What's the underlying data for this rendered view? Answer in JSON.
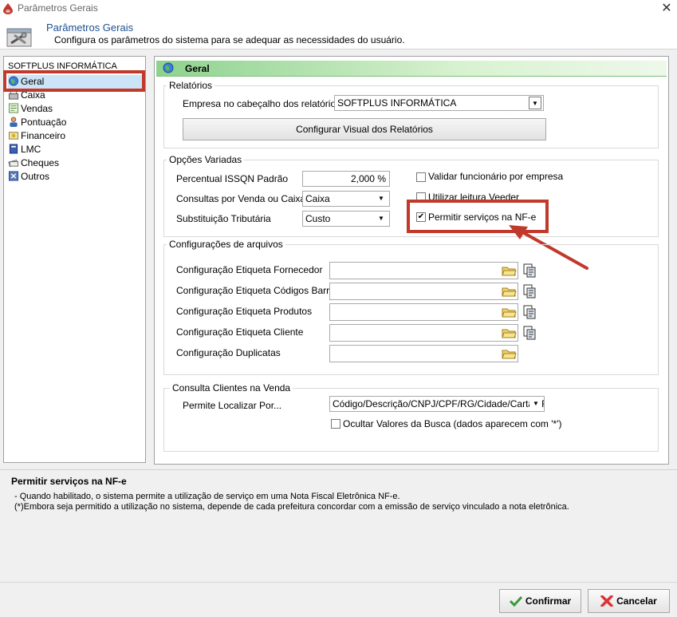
{
  "window": {
    "title": "Parâmetros Gerais"
  },
  "header": {
    "title": "Parâmetros Gerais",
    "description": "Configura os parâmetros do sistema para se adequar as necessidades do usuário."
  },
  "tree": {
    "root": "SOFTPLUS INFORMÁTICA",
    "items": [
      {
        "label": "Geral",
        "icon": "globe-icon",
        "selected": true
      },
      {
        "label": "Caixa",
        "icon": "cash-register-icon"
      },
      {
        "label": "Vendas",
        "icon": "sales-icon"
      },
      {
        "label": "Pontuação",
        "icon": "person-icon"
      },
      {
        "label": "Financeiro",
        "icon": "finance-icon"
      },
      {
        "label": "LMC",
        "icon": "book-icon"
      },
      {
        "label": "Cheques",
        "icon": "checks-icon"
      },
      {
        "label": "Outros",
        "icon": "others-icon"
      }
    ]
  },
  "section": {
    "title": "Geral"
  },
  "relatorios": {
    "title": "Relatórios",
    "empresa_label": "Empresa no cabeçalho dos relatórios",
    "empresa_value": "SOFTPLUS INFORMÁTICA",
    "configurar_button": "Configurar Visual dos Relatórios"
  },
  "opcoes": {
    "title": "Opções Variadas",
    "issqn_label": "Percentual ISSQN Padrão",
    "issqn_value": "2,000 %",
    "consultas_label": "Consultas por Venda ou Caixa",
    "consultas_value": "Caixa",
    "substituicao_label": "Substituição Tributária",
    "substituicao_value": "Custo",
    "chk_validar": {
      "label": "Validar funcionário por empresa",
      "checked": false
    },
    "chk_veeder": {
      "label": "Utilizar leitura Veeder",
      "checked": false
    },
    "chk_nfe": {
      "label": "Permitir serviços na NF-e",
      "checked": true
    }
  },
  "arquivos": {
    "title": "Configurações de arquivos",
    "rows": [
      {
        "label": "Configuração Etiqueta Fornecedor",
        "value": "",
        "copy": true
      },
      {
        "label": "Configuração Etiqueta Códigos Barras",
        "value": "",
        "copy": true
      },
      {
        "label": "Configuração Etiqueta Produtos",
        "value": "",
        "copy": true
      },
      {
        "label": "Configuração Etiqueta Cliente",
        "value": "",
        "copy": true
      },
      {
        "label": "Configuração Duplicatas",
        "value": "",
        "copy": false
      }
    ]
  },
  "clientes": {
    "title": "Consulta Clientes na Venda",
    "localizar_label": "Permite Localizar Por...",
    "localizar_value": "Código/Descrição/CNPJ/CPF/RG/Cidade/Cartão Fide",
    "chk_ocultar": {
      "label": "Ocultar Valores da Busca (dados aparecem com '*')",
      "checked": false
    }
  },
  "help": {
    "title": "Permitir serviços na NF-e",
    "line1": "- Quando habilitado, o sistema permite a utilização de serviço em uma Nota Fiscal Eletrônica NF-e.",
    "line2": "(*)Embora seja permitido a utilização no sistema, depende de cada prefeitura concordar com a emissão de serviço vinculado a nota eletrônica."
  },
  "footer": {
    "confirm_label": "Confirmar",
    "cancel_label": "Cancelar"
  },
  "colors": {
    "annotation": "#c0392b",
    "header_title": "#1f4f8f",
    "selection": "#cce4f7"
  }
}
